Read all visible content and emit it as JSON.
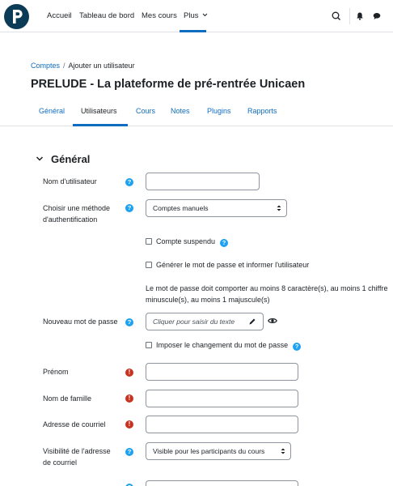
{
  "nav": {
    "logo_letter": "P",
    "links": [
      "Accueil",
      "Tableau de bord",
      "Mes cours",
      "Plus"
    ]
  },
  "breadcrumb": {
    "root": "Comptes",
    "sep": "/",
    "current": "Ajouter un utilisateur"
  },
  "page_title": "PRELUDE - La plateforme de pré-rentrée Unicaen",
  "tabs": [
    "Général",
    "Utilisateurs",
    "Cours",
    "Notes",
    "Plugins",
    "Rapports"
  ],
  "section": {
    "title": "Général"
  },
  "fields": {
    "username_label": "Nom d'utilisateur",
    "auth_label": "Choisir une méthode d'authentification",
    "auth_value": "Comptes manuels",
    "suspended_label": "Compte suspendu",
    "generate_pw_label": "Générer le mot de passe et informer l'utilisateur",
    "pw_note_line1": "Le mot de passe doit comporter au moins 8 caractère(s), au moins 1 chiffre",
    "pw_note_line2": "minuscule(s), au moins 1 majuscule(s)",
    "new_pw_label": "Nouveau mot de passe",
    "new_pw_placeholder": "Cliquer pour saisir du texte",
    "force_change_label": "Imposer le changement du mot de passe",
    "firstname_label": "Prénom",
    "lastname_label": "Nom de famille",
    "email_label": "Adresse de courriel",
    "email_visibility_label": "Visibilité de l'adresse de courriel",
    "email_visibility_value": "Visible pour les participants du cours"
  },
  "icons": {
    "help": "?",
    "required": "!"
  },
  "colors": {
    "accent": "#0f6cbf",
    "help": "#1da1f2",
    "required": "#ca3120",
    "logo_bg": "#0c3b58"
  }
}
